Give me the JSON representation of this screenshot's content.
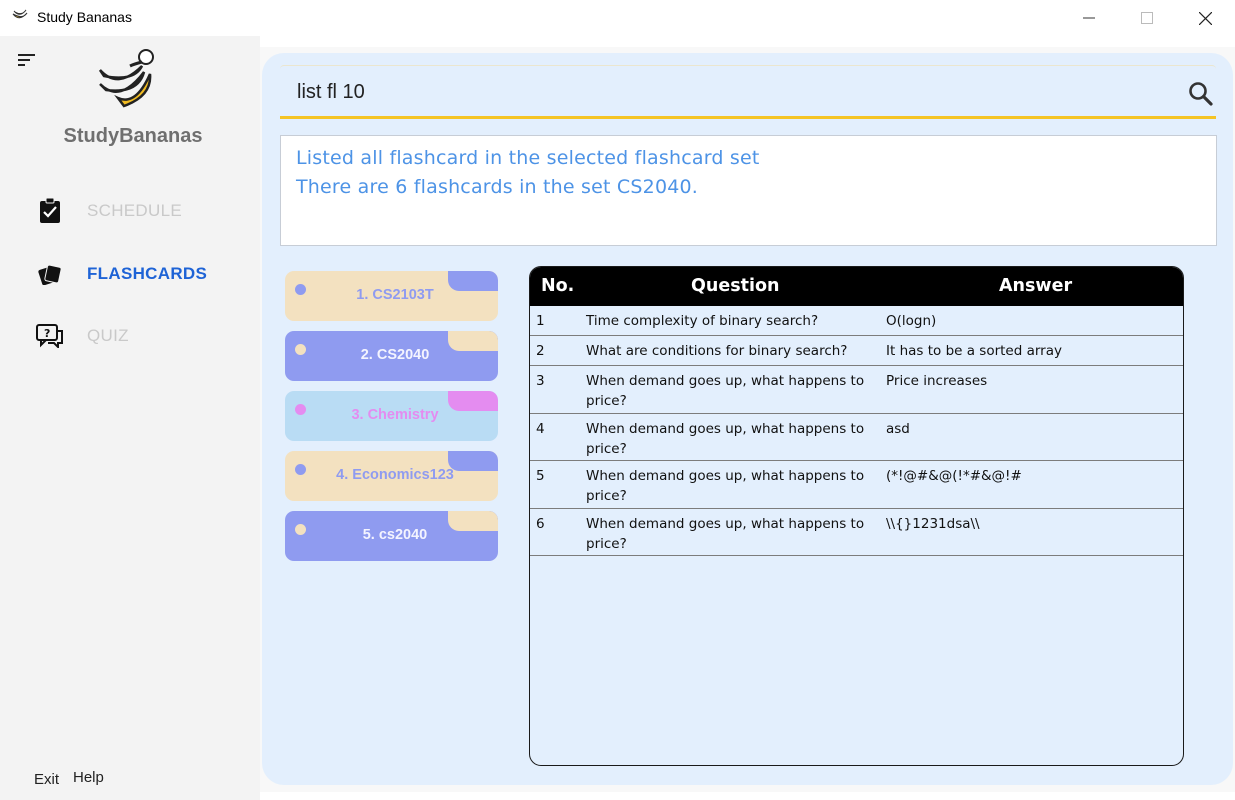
{
  "window": {
    "title": "Study Bananas"
  },
  "sidebar": {
    "brand": "StudyBananas",
    "nav": [
      {
        "label": "SCHEDULE",
        "icon": "clipboard-check-icon",
        "active": false
      },
      {
        "label": "FLASHCARDS",
        "icon": "flashcards-icon",
        "active": true
      },
      {
        "label": "QUIZ",
        "icon": "quiz-chat-icon",
        "active": false
      }
    ],
    "footer": {
      "exit": "Exit",
      "help": "Help"
    }
  },
  "command": {
    "value": "list fl 10"
  },
  "result": {
    "line1": "Listed all flashcard in the selected flashcard set",
    "line2": "There are 6 flashcards in the set CS2040."
  },
  "sets": [
    {
      "label": "1. CS2103T",
      "bg": "#f3e1c0",
      "accent": "#8f9bf0",
      "text": "#8f9bf0"
    },
    {
      "label": "2. CS2040",
      "bg": "#8f9bf0",
      "accent": "#f3e1c0",
      "text": "#f4f4ff"
    },
    {
      "label": "3. Chemistry",
      "bg": "#b9dcf4",
      "accent": "#e48cf0",
      "text": "#e48cf0"
    },
    {
      "label": "4. Economics123",
      "bg": "#f3e1c0",
      "accent": "#8f9bf0",
      "text": "#8f9bf0"
    },
    {
      "label": "5. cs2040",
      "bg": "#8f9bf0",
      "accent": "#f3e1c0",
      "text": "#f4f4ff"
    }
  ],
  "table": {
    "headers": {
      "no": "No.",
      "question": "Question",
      "answer": "Answer"
    },
    "rows": [
      {
        "no": "1",
        "question": "Time complexity of binary search?",
        "answer": "O(logn)"
      },
      {
        "no": "2",
        "question": "What are conditions for binary search?",
        "answer": "It has to be a sorted array"
      },
      {
        "no": "3",
        "question": "When demand goes up, what happens to price?",
        "answer": "Price increases"
      },
      {
        "no": "4",
        "question": "When demand goes up, what happens to price?",
        "answer": "asd"
      },
      {
        "no": "5",
        "question": "When demand goes up, what happens to price?",
        "answer": "(*!@#&@(!*#&@!#"
      },
      {
        "no": "6",
        "question": "When demand goes up, what happens to price?",
        "answer": "\\\\{}1231dsa\\\\"
      }
    ]
  }
}
